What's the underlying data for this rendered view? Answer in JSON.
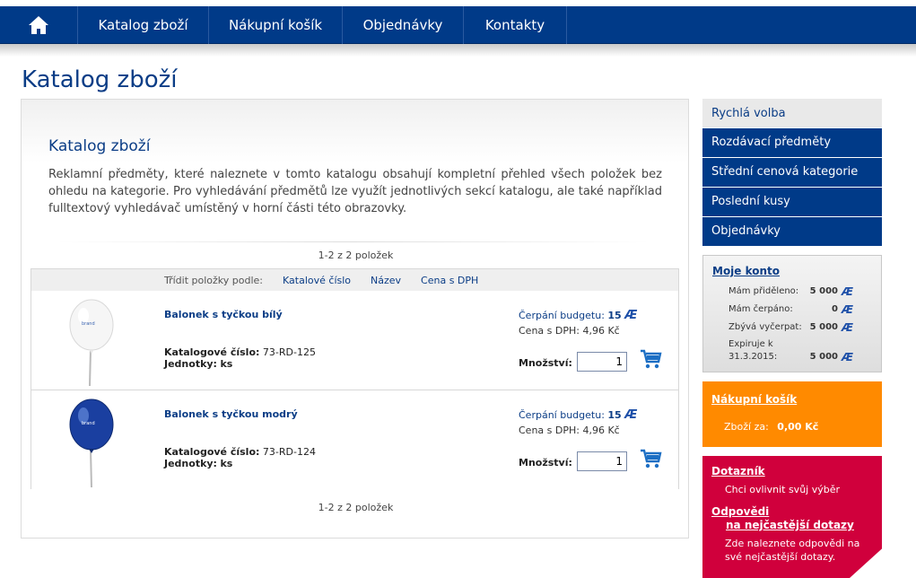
{
  "nav": {
    "home_icon": "home-icon",
    "items": [
      "Katalog zboží",
      "Nákupní košík",
      "Objednávky",
      "Kontakty"
    ]
  },
  "page_title": "Katalog zboží",
  "intro": {
    "title": "Katalog zboží",
    "text": "Reklamní předměty, které naleznete v tomto katalogu obsahují kompletní přehled všech položek bez ohledu na kategorie. Pro vyhledávání předmětů lze využít jednotlivých sekcí katalogu, ale také například fulltextový vyhledávač umístěný v horní části této obrazovky."
  },
  "pager": "1-2 z 2 položek",
  "sort": {
    "label": "Třídit položky podle:",
    "options": [
      "Katalové číslo",
      "Název",
      "Cena s DPH"
    ]
  },
  "products": [
    {
      "name": "Balonek s tyčkou bílý",
      "catalog_label": "Katalogové číslo:",
      "catalog_no": "73-RD-125",
      "unit_label": "Jednotky:",
      "unit": "ks",
      "budget_label": "Čerpání budgetu:",
      "budget": "15",
      "price_label": "Cena s DPH:",
      "price": "4,96 Kč",
      "qty_label": "Množství:",
      "qty": "1",
      "balloon_color": "#f4f4f4"
    },
    {
      "name": "Balonek s tyčkou modrý",
      "catalog_label": "Katalogové číslo:",
      "catalog_no": "73-RD-124",
      "unit_label": "Jednotky:",
      "unit": "ks",
      "budget_label": "Čerpání budgetu:",
      "budget": "15",
      "price_label": "Cena s DPH:",
      "price": "4,96 Kč",
      "qty_label": "Množství:",
      "qty": "1",
      "balloon_color": "#1a3fa0"
    }
  ],
  "sidebar": {
    "quick_title": "Rychlá volba",
    "quick_items": [
      "Rozdávací předměty",
      "Střední cenová kategorie",
      "Poslední kusy",
      "Objednávky"
    ],
    "account": {
      "title": "Moje konto",
      "rows": [
        {
          "label": "Mám přiděleno:",
          "value": "5 000"
        },
        {
          "label": "Mám čerpáno:",
          "value": "0"
        },
        {
          "label": "Zbývá vyčerpat:",
          "value": "5 000"
        },
        {
          "label": "Expiruje k",
          "label2": "31.3.2015:",
          "value": "5 000"
        }
      ]
    },
    "cart": {
      "title": "Nákupní košík",
      "label": "Zboží za:",
      "value": "0,00 Kč"
    },
    "quiz": {
      "title": "Dotazník",
      "desc": "Chci ovlivnit svůj výběr",
      "title2_line1": "Odpovědi",
      "title2_line2": "na nejčastější dotazy",
      "desc2": "Zde naleznete odpovědi na své nejčastější dotazy."
    }
  },
  "colors": {
    "nav_blue": "#003a88",
    "title_blue": "#0b3d86",
    "orange": "#ff8a00",
    "crimson": "#d0003c"
  }
}
